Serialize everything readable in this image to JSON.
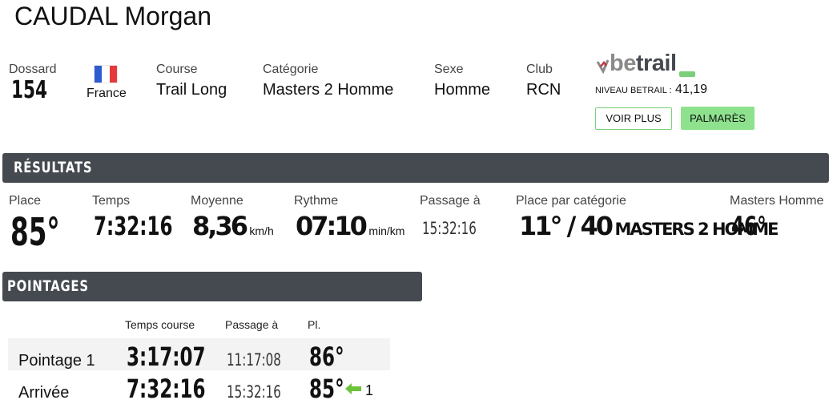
{
  "athlete": {
    "name": "CAUDAL Morgan"
  },
  "info": {
    "dossard_label": "Dossard",
    "dossard": "154",
    "country": "France",
    "course_label": "Course",
    "course": "Trail Long",
    "categorie_label": "Catégorie",
    "categorie": "Masters 2 Homme",
    "sexe_label": "Sexe",
    "sexe": "Homme",
    "club_label": "Club",
    "club": "RCN"
  },
  "betrail": {
    "logo_text": "betrail",
    "niveau_label": "NIVEAU BETRAIL :",
    "niveau_value": "41,19",
    "voir_plus": "VOIR PLUS",
    "palmares": "PALMARÈS"
  },
  "resultats": {
    "title": "RÉSULTATS",
    "place_label": "Place",
    "place": "85°",
    "temps_label": "Temps",
    "temps": "7:32:16",
    "moyenne_label": "Moyenne",
    "moyenne": "8,36",
    "moyenne_unit": "km/h",
    "rythme_label": "Rythme",
    "rythme": "07:10",
    "rythme_unit": "min/km",
    "passage_label": "Passage à",
    "passage": "15:32:16",
    "place_cat_label": "Place par catégorie",
    "place_cat": "11° / 40",
    "place_cat_name": "MASTERS 2 HOMME",
    "masters_label": "Masters Homme",
    "masters": "46°"
  },
  "pointages": {
    "title": "POINTAGES",
    "headers": {
      "temps": "Temps course",
      "passage": "Passage à",
      "pl": "Pl."
    },
    "rows": [
      {
        "label": "Pointage 1",
        "temps": "3:17:07",
        "passage": "11:17:08",
        "pl": "86°",
        "gain": ""
      },
      {
        "label": "Arrivée",
        "temps": "7:32:16",
        "passage": "15:32:16",
        "pl": "85°",
        "gain": "1"
      }
    ]
  },
  "colors": {
    "band": "#454a50",
    "btn_outline_border": "#7acf7a",
    "btn_fill": "#8ee28e",
    "arrow_green": "#6cc23a",
    "flag_blue": "#2f5bd0",
    "flag_red": "#e63a3a"
  }
}
